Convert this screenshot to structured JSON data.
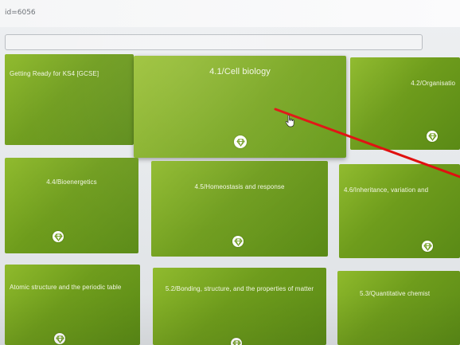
{
  "browser": {
    "url_fragment": "id=6056"
  },
  "search": {
    "placeholder": ""
  },
  "tiles": [
    {
      "title": "Getting Ready for KS4 [GCSE]",
      "badge_icon": "diamond-icon"
    },
    {
      "title": "4.1/Cell biology",
      "badge_icon": "diamond-icon"
    },
    {
      "title": "4.2/Organisatio",
      "badge_icon": "diamond-icon"
    },
    {
      "title": "4.4/Bioenergetics",
      "badge_icon": "diamond-icon"
    },
    {
      "title": "4.5/Homeostasis and response",
      "badge_icon": "diamond-icon"
    },
    {
      "title": "4.6/Inheritance, variation and",
      "badge_icon": "diamond-icon"
    },
    {
      "title": "Atomic structure and the periodic table",
      "badge_icon": "diamond-icon"
    },
    {
      "title": "5.2/Bonding, structure, and the properties of matter",
      "badge_icon": "diamond-icon"
    },
    {
      "title": "5.3/Quantitative chemist",
      "badge_icon": "diamond-icon"
    }
  ],
  "colors": {
    "tile_green": "#6e9c1c",
    "annotation_arrow": "#e01010"
  }
}
